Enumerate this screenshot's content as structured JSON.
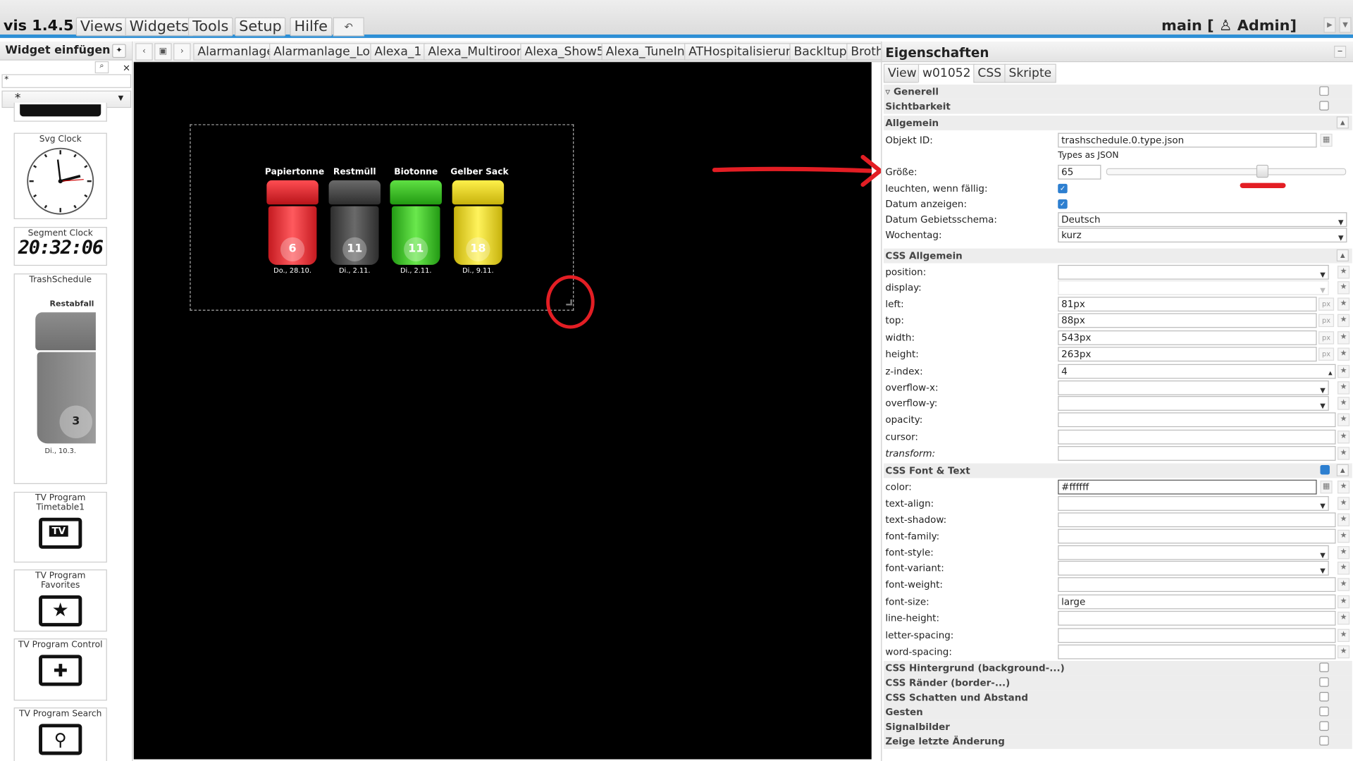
{
  "app": {
    "name": "vis 1.4.5"
  },
  "menu": [
    "Views",
    "Widgets",
    "Tools",
    "Setup",
    "Hilfe"
  ],
  "undo_icon": "undo-arrow-icon",
  "header_right": {
    "view": "main",
    "user": "[ ♙ Admin]"
  },
  "palette": {
    "title": "Widget einfügen",
    "filter_value": "*",
    "set_value": "*",
    "widgets": [
      {
        "label": "Svg Clock"
      },
      {
        "label": "Segment Clock",
        "time": "20:32:06"
      },
      {
        "label": "TrashSchedule",
        "preview_title": "Restabfall",
        "preview_num": "3",
        "preview_date": "Di., 10.3."
      },
      {
        "label": "TV Program Timetable1",
        "icon_text": "TV"
      },
      {
        "label": "TV Program Favorites"
      },
      {
        "label": "TV Program Control"
      },
      {
        "label": "TV Program Search"
      }
    ]
  },
  "view_tabs": [
    "Alarmanlage",
    "Alarmanlage_Log",
    "Alexa_1",
    "Alexa_Multiroom",
    "Alexa_Show5",
    "Alexa_TuneIn",
    "ATHospitalisierung",
    "BackItup",
    "Brothe"
  ],
  "trash": [
    {
      "label": "Papiertonne",
      "num": "6",
      "date": "Do., 28.10.",
      "color": "#e2242a"
    },
    {
      "label": "Restmüll",
      "num": "11",
      "date": "Di., 2.11.",
      "color": "#444444"
    },
    {
      "label": "Biotonne",
      "num": "11",
      "date": "Di., 2.11.",
      "color": "#3bc424"
    },
    {
      "label": "Gelber Sack",
      "num": "18",
      "date": "Di., 9.11.",
      "color": "#e8d21a"
    }
  ],
  "props": {
    "title": "Eigenschaften",
    "tabs": [
      "View",
      "w01052",
      "CSS",
      "Skripte"
    ],
    "sections": {
      "generell": "Generell",
      "sichtbarkeit": "Sichtbarkeit",
      "allgemein": "Allgemein",
      "css_allgemein": "CSS Allgemein",
      "css_font": "CSS Font & Text",
      "bg": "CSS Hintergrund (background-...)",
      "border": "CSS Ränder (border-...)",
      "shadow": "CSS Schatten und Abstand",
      "gesten": "Gesten",
      "signal": "Signalbilder",
      "last": "Zeige letzte Änderung"
    },
    "allgemein": {
      "objid_label": "Objekt ID:",
      "objid_value": "trashschedule.0.type.json",
      "objid_hint": "Types as JSON",
      "size_label": "Größe:",
      "size_value": "65",
      "size_slider": 0.65,
      "glow_label": "leuchten, wenn fällig:",
      "glow_checked": true,
      "date_label": "Datum anzeigen:",
      "date_checked": true,
      "locale_label": "Datum Gebietsschema:",
      "locale_value": "Deutsch",
      "weekday_label": "Wochentag:",
      "weekday_value": "kurz"
    },
    "css": {
      "position": {
        "label": "position:",
        "value": ""
      },
      "display": {
        "label": "display:",
        "value": ""
      },
      "left": {
        "label": "left:",
        "value": "81px",
        "unit": "px"
      },
      "top": {
        "label": "top:",
        "value": "88px",
        "unit": "px"
      },
      "width": {
        "label": "width:",
        "value": "543px",
        "unit": "px"
      },
      "height": {
        "label": "height:",
        "value": "263px",
        "unit": "px"
      },
      "zindex": {
        "label": "z-index:",
        "value": "4"
      },
      "overflowx": {
        "label": "overflow-x:",
        "value": ""
      },
      "overflowy": {
        "label": "overflow-y:",
        "value": ""
      },
      "opacity": {
        "label": "opacity:",
        "value": ""
      },
      "cursor": {
        "label": "cursor:",
        "value": ""
      },
      "transform": {
        "label": "transform:",
        "value": ""
      }
    },
    "font": {
      "color": {
        "label": "color:",
        "value": "#ffffff"
      },
      "textalign": {
        "label": "text-align:",
        "value": ""
      },
      "textshadow": {
        "label": "text-shadow:",
        "value": ""
      },
      "fontfamily": {
        "label": "font-family:",
        "value": ""
      },
      "fontstyle": {
        "label": "font-style:",
        "value": ""
      },
      "fontvariant": {
        "label": "font-variant:",
        "value": ""
      },
      "fontweight": {
        "label": "font-weight:",
        "value": ""
      },
      "fontsize": {
        "label": "font-size:",
        "value": "large"
      },
      "lineheight": {
        "label": "line-height:",
        "value": ""
      },
      "letterspacing": {
        "label": "letter-spacing:",
        "value": ""
      },
      "wordspacing": {
        "label": "word-spacing:",
        "value": ""
      }
    }
  },
  "annotation_color": "#e31e24",
  "accent": "#2d8fd5"
}
